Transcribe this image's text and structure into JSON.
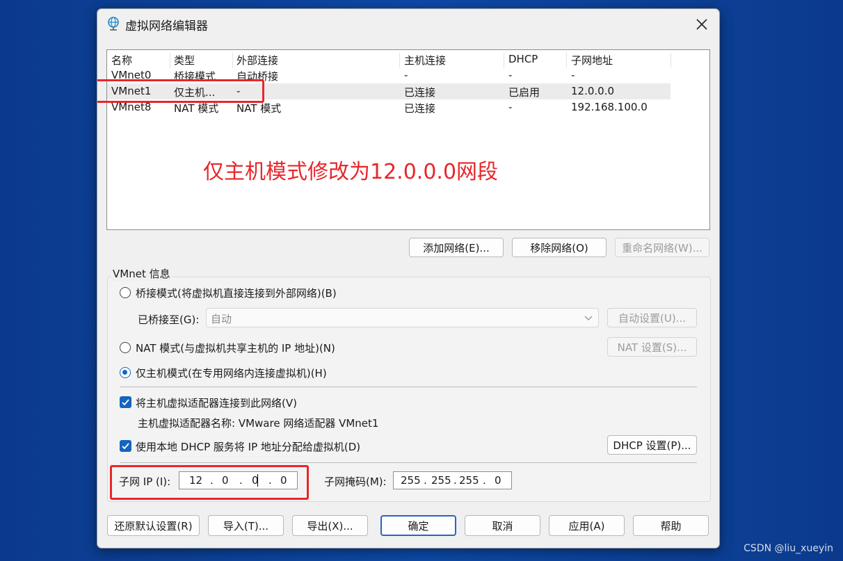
{
  "window": {
    "title": "虚拟网络编辑器"
  },
  "list": {
    "headers": [
      "名称",
      "类型",
      "外部连接",
      "主机连接",
      "DHCP",
      "子网地址"
    ],
    "rows": [
      [
        "VMnet0",
        "桥接模式",
        "自动桥接",
        "-",
        "-",
        "-"
      ],
      [
        "VMnet1",
        "仅主机...",
        "-",
        "已连接",
        "已启用",
        "12.0.0.0"
      ],
      [
        "VMnet8",
        "NAT 模式",
        "NAT 模式",
        "已连接",
        "-",
        "192.168.100.0"
      ]
    ],
    "annotation": "仅主机模式修改为12.0.0.0网段"
  },
  "list_buttons": {
    "add": "添加网络(E)...",
    "remove": "移除网络(O)",
    "rename": "重命名网络(W)..."
  },
  "info": {
    "group_title": "VMnet 信息",
    "bridged": {
      "label": "桥接模式(将虚拟机直接连接到外部网络)(B)",
      "selected": false
    },
    "bridged_to_label": "已桥接至(G):",
    "bridged_to_value": "自动",
    "auto_settings": "自动设置(U)...",
    "nat": {
      "label": "NAT 模式(与虚拟机共享主机的 IP 地址)(N)",
      "selected": false
    },
    "nat_settings": "NAT 设置(S)...",
    "hostonly": {
      "label": "仅主机模式(在专用网络内连接虚拟机)(H)",
      "selected": true
    },
    "connect_adapter": {
      "label": "将主机虚拟适配器连接到此网络(V)",
      "checked": true
    },
    "adapter_name": "主机虚拟适配器名称: VMware 网络适配器 VMnet1",
    "use_dhcp": {
      "label": "使用本地 DHCP 服务将 IP 地址分配给虚拟机(D)",
      "checked": true
    },
    "dhcp_settings": "DHCP 设置(P)...",
    "subnet_ip_label": "子网 IP (I):",
    "subnet_ip": [
      "12",
      "0",
      "0",
      "0"
    ],
    "subnet_mask_label": "子网掩码(M):",
    "subnet_mask": [
      "255",
      "255",
      "255",
      "0"
    ]
  },
  "footer": {
    "restore": "还原默认设置(R)",
    "import": "导入(T)...",
    "export": "导出(X)...",
    "ok": "确定",
    "cancel": "取消",
    "apply": "应用(A)",
    "help": "帮助"
  },
  "watermark": "CSDN @liu_xueyin",
  "colors": {
    "accent": "#1565c0",
    "annotation": "#e8262a",
    "desktop": "#0a3d91"
  }
}
